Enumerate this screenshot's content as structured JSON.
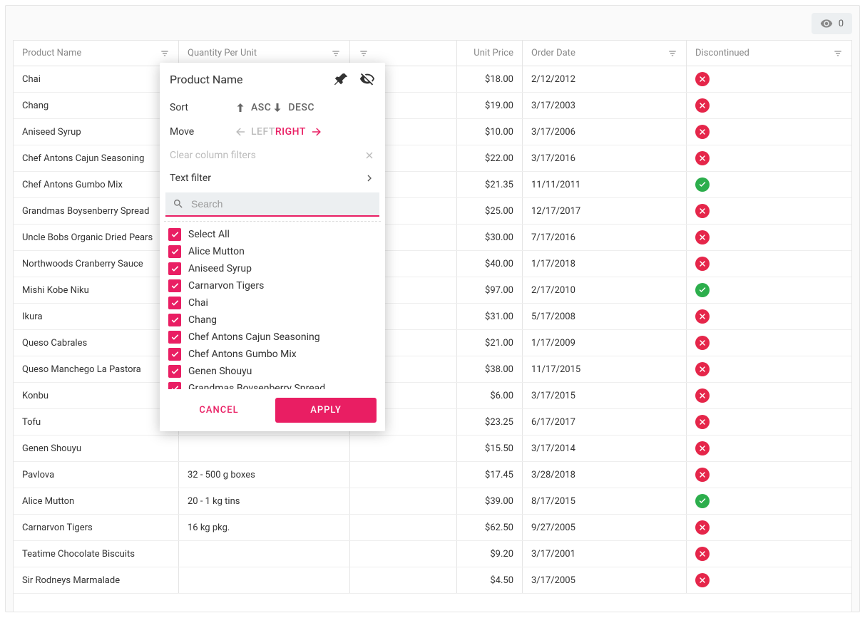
{
  "toolbar": {
    "hidden_cols": "0"
  },
  "columns": {
    "product_name": "Product Name",
    "qty": "Quantity Per Unit",
    "unit_price": "Unit Price",
    "order_date": "Order Date",
    "discontinued": "Discontinued"
  },
  "rows": [
    {
      "name": "Chai",
      "qty": "",
      "price": "$18.00",
      "date": "2/12/2012",
      "disc": false
    },
    {
      "name": "Chang",
      "qty": "",
      "price": "$19.00",
      "date": "3/17/2003",
      "disc": false
    },
    {
      "name": "Aniseed Syrup",
      "qty": "",
      "price": "$10.00",
      "date": "3/17/2006",
      "disc": false
    },
    {
      "name": "Chef Antons Cajun Seasoning",
      "qty": "",
      "price": "$22.00",
      "date": "3/17/2016",
      "disc": false
    },
    {
      "name": "Chef Antons Gumbo Mix",
      "qty": "",
      "price": "$21.35",
      "date": "11/11/2011",
      "disc": true
    },
    {
      "name": "Grandmas Boysenberry Spread",
      "qty": "",
      "price": "$25.00",
      "date": "12/17/2017",
      "disc": false
    },
    {
      "name": "Uncle Bobs Organic Dried Pears",
      "qty": "",
      "price": "$30.00",
      "date": "7/17/2016",
      "disc": false
    },
    {
      "name": "Northwoods Cranberry Sauce",
      "qty": "",
      "price": "$40.00",
      "date": "1/17/2018",
      "disc": false
    },
    {
      "name": "Mishi Kobe Niku",
      "qty": "",
      "price": "$97.00",
      "date": "2/17/2010",
      "disc": true
    },
    {
      "name": "Ikura",
      "qty": "",
      "price": "$31.00",
      "date": "5/17/2008",
      "disc": false
    },
    {
      "name": "Queso Cabrales",
      "qty": "",
      "price": "$21.00",
      "date": "1/17/2009",
      "disc": false
    },
    {
      "name": "Queso Manchego La Pastora",
      "qty": "",
      "price": "$38.00",
      "date": "11/17/2015",
      "disc": false
    },
    {
      "name": "Konbu",
      "qty": "",
      "price": "$6.00",
      "date": "3/17/2015",
      "disc": false
    },
    {
      "name": "Tofu",
      "qty": "",
      "price": "$23.25",
      "date": "6/17/2017",
      "disc": false
    },
    {
      "name": "Genen Shouyu",
      "qty": "",
      "price": "$15.50",
      "date": "3/17/2014",
      "disc": false
    },
    {
      "name": "Pavlova",
      "qty": "32 - 500 g boxes",
      "price": "$17.45",
      "date": "3/28/2018",
      "disc": false
    },
    {
      "name": "Alice Mutton",
      "qty": "20 - 1 kg tins",
      "price": "$39.00",
      "date": "8/17/2015",
      "disc": true
    },
    {
      "name": "Carnarvon Tigers",
      "qty": "16 kg pkg.",
      "price": "$62.50",
      "date": "9/27/2005",
      "disc": false
    },
    {
      "name": "Teatime Chocolate Biscuits",
      "qty": "",
      "price": "$9.20",
      "date": "3/17/2001",
      "disc": false
    },
    {
      "name": "Sir Rodneys Marmalade",
      "qty": "",
      "price": "$4.50",
      "date": "3/17/2005",
      "disc": false
    }
  ],
  "popup": {
    "title": "Product Name",
    "sort_label": "Sort",
    "asc": "ASC",
    "desc": "DESC",
    "move_label": "Move",
    "left": "LEFT",
    "right": "RIGHT",
    "clear": "Clear column filters",
    "text_filter": "Text filter",
    "search_placeholder": "Search",
    "select_all": "Select All",
    "items": [
      "Alice Mutton",
      "Aniseed Syrup",
      "Carnarvon Tigers",
      "Chai",
      "Chang",
      "Chef Antons Cajun Seasoning",
      "Chef Antons Gumbo Mix",
      "Genen Shouyu",
      "Grandmas Boysenberry Spread"
    ],
    "cancel": "CANCEL",
    "apply": "APPLY"
  }
}
